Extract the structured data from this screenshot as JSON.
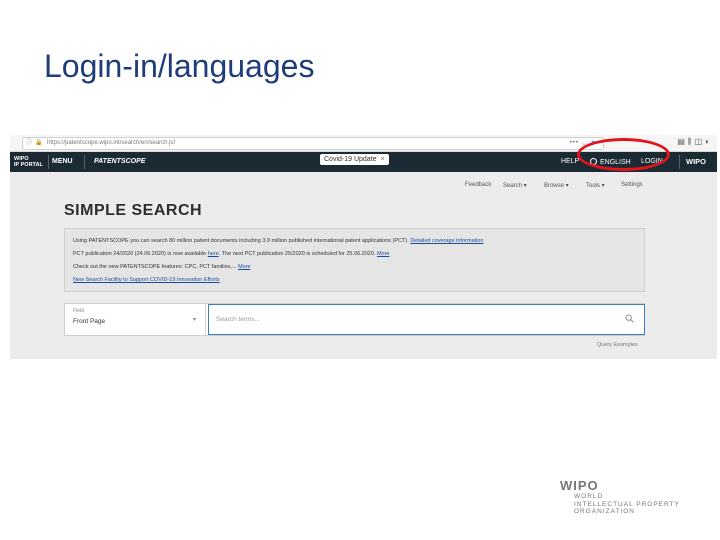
{
  "slide": {
    "title": "Login-in/languages"
  },
  "browser": {
    "url": "https://patentscope.wipo.int/search/en/search.jsf",
    "dots": "•••",
    "icons": [
      "reader-icon",
      "library-icon",
      "sidebar-icon",
      "extension-icon"
    ]
  },
  "portal": {
    "wipo_ip_line1": "WIPO",
    "wipo_ip_line2": "IP PORTAL",
    "menu_label": "MENU",
    "product_label": "PATENTSCOPE",
    "covid_label": "Covid-19 Update",
    "covid_close": "×",
    "help_label": "HELP",
    "language_label": "ENGLISH",
    "login_label": "LOGIN",
    "wipo_label": "WIPO",
    "highlight_color": "#e0151d"
  },
  "nav": {
    "items": [
      "Feedback",
      "Search ▾",
      "Browse ▾",
      "Tools ▾",
      "Settings"
    ]
  },
  "page": {
    "heading": "SIMPLE SEARCH",
    "info": {
      "line1_text": "Using PATENTSCOPE you can search 80 million patent documents including 3.9 million published international patent applications (PCT). ",
      "line1_link": "Detailed coverage information",
      "line2_text": "PCT publication 24/2020 (24.06.2020) is now available ",
      "line2_link1": "here",
      "line2_text2": ". The next PCT publication 25/2020 is scheduled for 25.06.2020. ",
      "line2_link2": "More",
      "line3_text": "Check out the new PATENTSCOPE features: CPC, PCT families,... ",
      "line3_link": "More",
      "line4_link": "New Search Facility to Support COVID-19 Innovation Efforts"
    },
    "field": {
      "label": "Field",
      "value": "Front Page"
    },
    "search": {
      "placeholder": "Search terms..."
    },
    "query_examples": "Query Examples"
  },
  "footer_logo": {
    "wipo": "WIPO",
    "line1": "WORLD",
    "line2": "INTELLECTUAL PROPERTY",
    "line3": "ORGANIZATION"
  }
}
